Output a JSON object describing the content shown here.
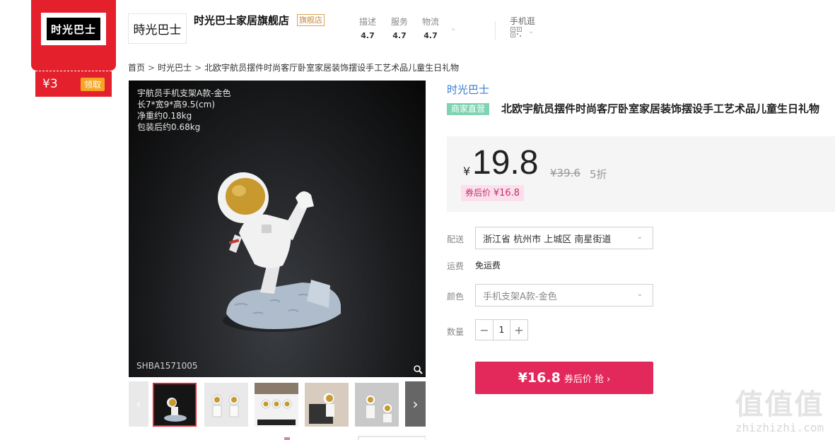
{
  "coupon": {
    "logo_text": "时光巴士",
    "amount": "¥3",
    "claim_label": "领取"
  },
  "shop": {
    "logo_text": "時光巴士",
    "name": "时光巴士家居旗舰店",
    "badge": "旗舰店",
    "ratings": [
      {
        "label": "描述",
        "value": "4.7"
      },
      {
        "label": "服务",
        "value": "4.7"
      },
      {
        "label": "物流",
        "value": "4.7"
      }
    ],
    "mobile_label": "手机逛"
  },
  "breadcrumb": {
    "home": "首页",
    "shop": "时光巴士",
    "current": "北欧宇航员摆件时尚客厅卧室家居装饰摆设手工艺术品儿童生日礼物"
  },
  "image": {
    "caption_lines": [
      "宇航员手机支架A款-金色",
      "长7*宽9*高9.5(cm)",
      "净重约0.18kg",
      "包装后约0.68kg"
    ],
    "sku": "SHBA1571005"
  },
  "product": {
    "brand": "时光巴士",
    "tag": "商家直营",
    "title": "北欧宇航员摆件时尚客厅卧室家居装饰摆设手工艺术品儿童生日礼物"
  },
  "price": {
    "currency": "¥",
    "current": "19.8",
    "original": "¥39.6",
    "discount": "5折",
    "after_coupon_label": "券后价",
    "after_coupon_value": "¥16.8"
  },
  "options": {
    "shipping_label": "配送",
    "shipping_value": "浙江省 杭州市 上城区 南星街道",
    "freight_label": "运费",
    "freight_value": "免运费",
    "color_label": "颜色",
    "color_value": "手机支架A款-金色",
    "qty_label": "数量",
    "qty_value": "1"
  },
  "buy_button": {
    "price": "¥16.8",
    "label": "券后价 抢 ›"
  },
  "watermark": {
    "chars": "值值值",
    "url": "zhizhizhi.com"
  },
  "colors": {
    "coupon_red": "#e5202d",
    "buy_pink": "#e3295b",
    "brand_blue": "#3a7bd5",
    "tag_green": "#7fd3b3"
  }
}
